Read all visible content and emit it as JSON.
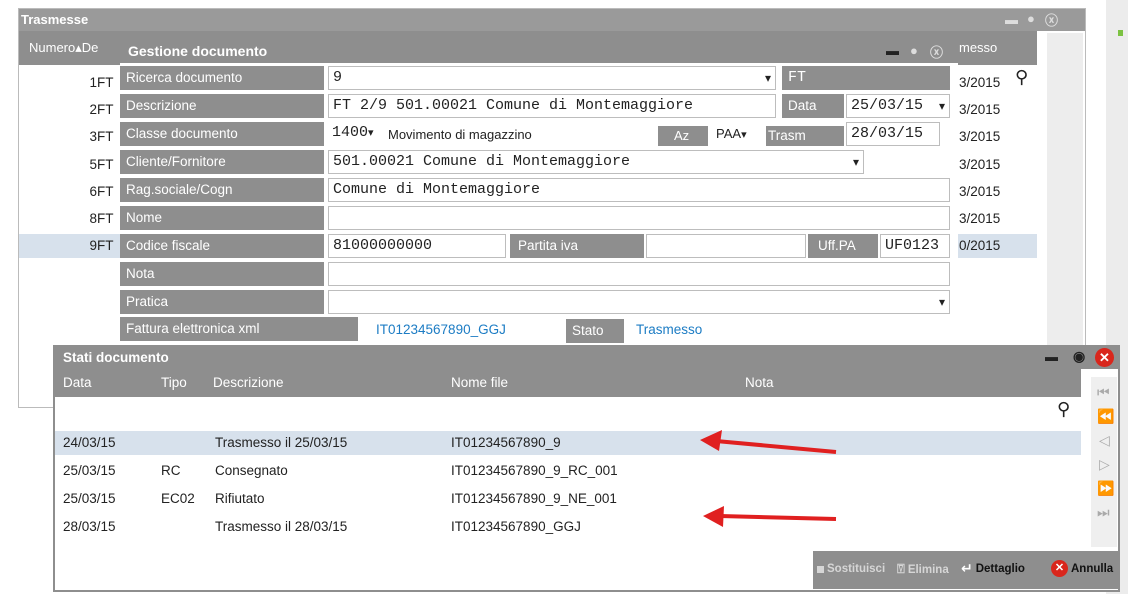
{
  "trasmesse": {
    "title": "Trasmesse",
    "col_numero": "Numero",
    "col_de": "De",
    "col_trasmesso": "messo",
    "rows": [
      {
        "num": "1",
        "tipo": "FT",
        "date": "3/2015"
      },
      {
        "num": "2",
        "tipo": "FT",
        "date": "3/2015"
      },
      {
        "num": "3",
        "tipo": "FT",
        "date": "3/2015"
      },
      {
        "num": "5",
        "tipo": "FT",
        "date": "3/2015"
      },
      {
        "num": "6",
        "tipo": "FT",
        "date": "3/2015"
      },
      {
        "num": "8",
        "tipo": "FT",
        "date": "3/2015"
      },
      {
        "num": "9",
        "tipo": "FT",
        "date": "0/2015"
      }
    ]
  },
  "gestione": {
    "title": "Gestione documento",
    "ricerca_label": "Ricerca documento",
    "ricerca_value": "9",
    "ricerca_tag": "FT",
    "descrizione_label": "Descrizione",
    "descrizione_value": "FT 2/9 501.00021 Comune di Montemaggiore",
    "data_label": "Data",
    "data_value": "25/03/15",
    "classe_label": "Classe documento",
    "classe_value": "1400",
    "classe_desc": "Movimento di magazzino",
    "az_label": "Az",
    "az_value": "PAA",
    "trasm_label": "Trasm",
    "trasm_value": "28/03/15",
    "cliente_label": "Cliente/Fornitore",
    "cliente_value": "501.00021 Comune di Montemaggiore",
    "ragsoc_label": "Rag.sociale/Cogn",
    "ragsoc_value": "Comune di Montemaggiore",
    "nome_label": "Nome",
    "nome_value": "",
    "cf_label": "Codice fiscale",
    "cf_value": "81000000000",
    "piva_label": "Partita iva",
    "piva_value": "",
    "uffpa_label": "Uff.PA",
    "uffpa_value": "UF0123",
    "nota_label": "Nota",
    "nota_value": "",
    "pratica_label": "Pratica",
    "pratica_value": "",
    "fe_label": "Fattura elettronica xml",
    "fe_value": "IT01234567890_GGJ",
    "stato_label": "Stato",
    "stato_value": "Trasmesso"
  },
  "stati": {
    "title": "Stati documento",
    "headers": {
      "data": "Data",
      "tipo": "Tipo",
      "descrizione": "Descrizione",
      "nome_file": "Nome file",
      "nota": "Nota"
    },
    "rows": [
      {
        "data": "24/03/15",
        "tipo": "",
        "descrizione": "Trasmesso il 25/03/15",
        "nome_file": "IT01234567890_9"
      },
      {
        "data": "25/03/15",
        "tipo": "RC",
        "descrizione": "Consegnato",
        "nome_file": "IT01234567890_9_RC_001"
      },
      {
        "data": "25/03/15",
        "tipo": "EC02",
        "descrizione": "Rifiutato",
        "nome_file": "IT01234567890_9_NE_001"
      },
      {
        "data": "28/03/15",
        "tipo": "",
        "descrizione": "Trasmesso il 28/03/15",
        "nome_file": "IT01234567890_GGJ"
      }
    ],
    "buttons": {
      "sostituisci": "Sostituisci",
      "elimina": "Elimina",
      "dettaglio": "Dettaglio",
      "annulla": "Annulla"
    }
  },
  "colors": {
    "header_gray": "#8e8e8e",
    "selected_row": "#d7e1ec",
    "link_blue": "#1c7cc4",
    "arrow_red": "#e02020",
    "close_red": "#d9261c"
  }
}
